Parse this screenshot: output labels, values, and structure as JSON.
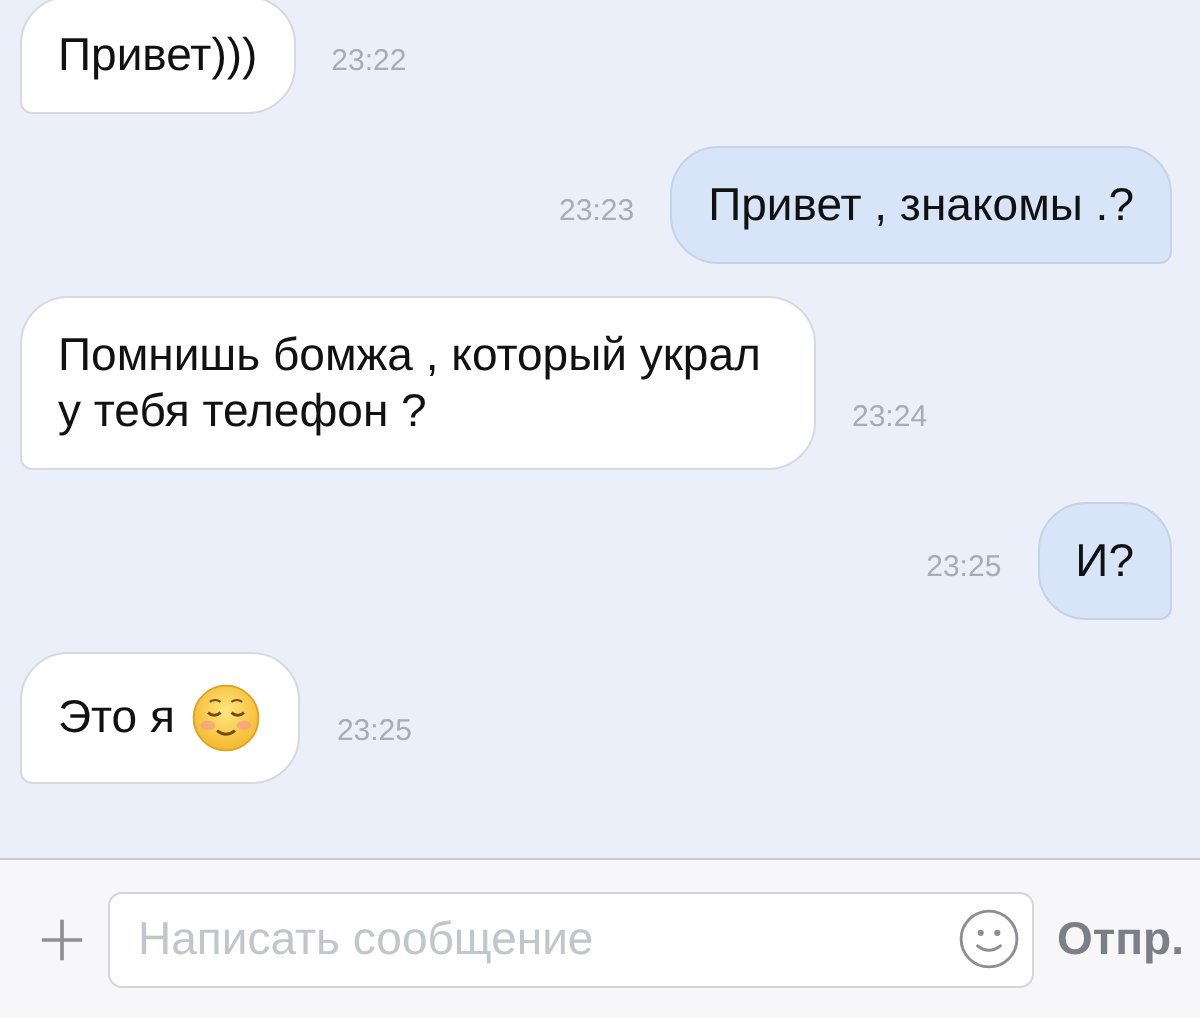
{
  "messages": [
    {
      "kind": "incoming",
      "text": "Привет)))",
      "time": "23:22"
    },
    {
      "kind": "outgoing",
      "text": "Привет , знакомы .?",
      "time": "23:23"
    },
    {
      "kind": "incoming",
      "text": "Помнишь бомжа , который украл у тебя телефон ?",
      "time": "23:24"
    },
    {
      "kind": "outgoing",
      "text": "И?",
      "time": "23:25"
    },
    {
      "kind": "incoming",
      "text": "Это я",
      "emoji": true,
      "time": "23:25"
    }
  ],
  "composer": {
    "placeholder": "Написать сообщение",
    "send_label": "Отпр."
  }
}
